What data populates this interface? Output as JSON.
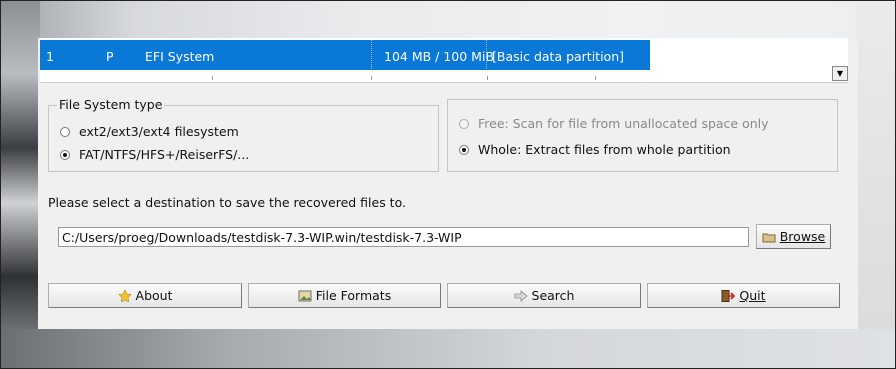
{
  "partition": {
    "number": "1",
    "flag": "P",
    "type": "EFI System",
    "size": "104 MB / 100 MiB",
    "label": "[Basic data partition]"
  },
  "filesystem_group": {
    "title": "File System type",
    "options": [
      {
        "label": "ext2/ext3/ext4 filesystem",
        "selected": false
      },
      {
        "label": "FAT/NTFS/HFS+/ReiserFS/...",
        "selected": true
      }
    ]
  },
  "scan_group": {
    "options": [
      {
        "label": "Free: Scan for file from unallocated space only",
        "selected": false,
        "enabled": false
      },
      {
        "label": "Whole: Extract files from whole partition",
        "selected": true,
        "enabled": true
      }
    ]
  },
  "destination": {
    "prompt": "Please select a destination to save the recovered files to.",
    "path": "C:/Users/proeg/Downloads/testdisk-7.3-WIP.win/testdisk-7.3-WIP",
    "browse_label": "Browse"
  },
  "buttons": {
    "about": "About",
    "file_formats": "File Formats",
    "search": "Search",
    "quit": "Quit"
  },
  "icons": {
    "about": "star-icon",
    "file_formats": "image-file-icon",
    "search": "arrow-right-icon",
    "quit": "exit-door-icon",
    "browse": "folder-icon"
  }
}
